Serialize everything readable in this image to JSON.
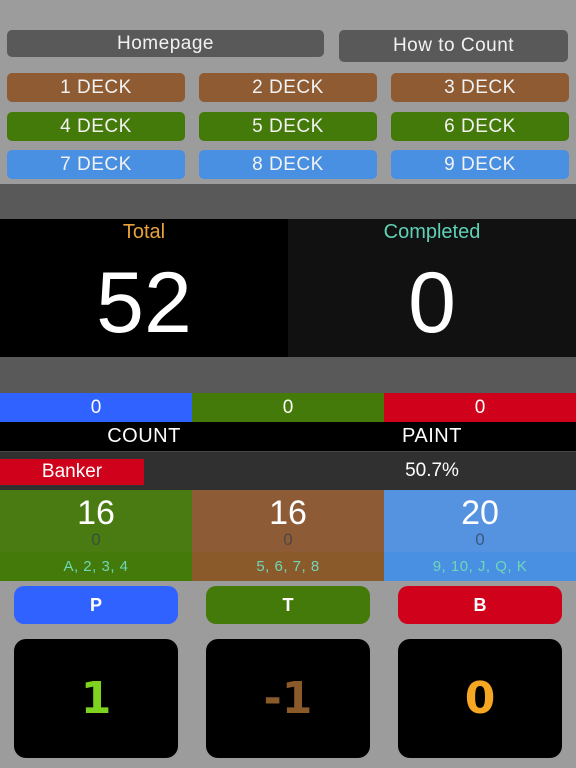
{
  "nav": {
    "homepage_label": "Homepage",
    "how_to_count_label": "How to Count"
  },
  "decks": [
    {
      "label": "1 DECK",
      "color": "#8e5b32"
    },
    {
      "label": "2 DECK",
      "color": "#8e5b32"
    },
    {
      "label": "3 DECK",
      "color": "#8e5b32"
    },
    {
      "label": "4 DECK",
      "color": "#437a09"
    },
    {
      "label": "5 DECK",
      "color": "#437a09"
    },
    {
      "label": "6 DECK",
      "color": "#437a09"
    },
    {
      "label": "7 DECK",
      "color": "#4a90e2"
    },
    {
      "label": "8 DECK",
      "color": "#4a90e2"
    },
    {
      "label": "9 DECK",
      "color": "#4a90e2"
    }
  ],
  "stats": {
    "total_label": "Total",
    "total_value": "52",
    "total_label_color": "#e8a33a",
    "completed_label": "Completed",
    "completed_value": "0",
    "completed_label_color": "#5fd1b5"
  },
  "tally_bar": [
    {
      "value": "0",
      "color": "#2f62ff"
    },
    {
      "value": "0",
      "color": "#437a09"
    },
    {
      "value": "0",
      "color": "#d0021b"
    }
  ],
  "labels": {
    "count": "COUNT",
    "paint": "PAINT"
  },
  "prediction": {
    "side": "Banker",
    "side_color": "#d0021b",
    "percentage": "50.7%"
  },
  "card_groups": [
    {
      "remaining": "16",
      "used": "0",
      "cards": "A, 2, 3, 4",
      "color": "#4a7b12"
    },
    {
      "remaining": "16",
      "used": "0",
      "cards": "5, 6, 7, 8",
      "color": "#8e5b37"
    },
    {
      "remaining": "20",
      "used": "0",
      "cards": "9, 10, J, Q, K",
      "color": "#5592e0"
    }
  ],
  "outcome_buttons": [
    {
      "label": "P",
      "color": "#2f62ff"
    },
    {
      "label": "T",
      "color": "#437a09"
    },
    {
      "label": "B",
      "color": "#d0021b"
    }
  ],
  "scores": [
    {
      "value": "1",
      "color": "#7ed321"
    },
    {
      "value": "-1",
      "color": "#8b5a2b"
    },
    {
      "value": "0",
      "color": "#f5a623"
    }
  ]
}
